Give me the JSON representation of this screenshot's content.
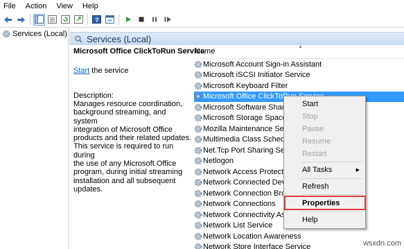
{
  "menu": [
    "File",
    "Action",
    "View",
    "Help"
  ],
  "toolbar": {
    "buttons": [
      "back-icon",
      "forward-icon",
      "show-hide-console-tree-icon",
      "export-list-icon",
      "refresh-icon",
      "properties-icon",
      "help-icon",
      "console-icon",
      "start-service-icon",
      "stop-service-icon",
      "pause-service-icon",
      "restart-service-icon"
    ],
    "colors": {
      "play": "#2a9d3a",
      "stop": "#333333"
    }
  },
  "tree": {
    "root_label": "Services (Local)"
  },
  "header": {
    "title": "Services (Local)"
  },
  "description_pane": {
    "service_name": "Microsoft Office ClickToRun Service",
    "start_link": "Start",
    "start_suffix": " the service",
    "description_label": "Description:",
    "description_lines": [
      "Manages resource coordination,",
      "background streaming, and system",
      "integration of Microsoft Office",
      "products and their related updates.",
      "This service is required to run during",
      "the use of any Microsoft Office",
      "program, during initial streaming",
      "installation and all subsequent",
      "updates."
    ]
  },
  "list": {
    "column_name": "Name",
    "selected_index": 3,
    "rows": [
      "Microsoft Account Sign-in Assistant",
      "Microsoft iSCSI Initiator Service",
      "Microsoft Keyboard Filter",
      "Microsoft Office ClickToRun Service",
      "Microsoft Software Shadow",
      "Microsoft Storage Spaces S",
      "Mozilla Maintenance Servi",
      "Multimedia Class Schedule",
      "Net.Tcp Port Sharing Servi",
      "Netlogon",
      "Network Access Protection",
      "Network Connected Devic",
      "Network Connection Brok",
      "Network Connections",
      "Network Connectivity Assi",
      "Network List Service",
      "Network Location Awareness",
      "Network Store Interface Service"
    ]
  },
  "context_menu": {
    "start": "Start",
    "stop": "Stop",
    "pause": "Pause",
    "resume": "Resume",
    "restart": "Restart",
    "all_tasks": "All Tasks",
    "refresh": "Refresh",
    "properties": "Properties",
    "help": "Help",
    "highlight_color": "#e03c3c"
  },
  "watermark": "wsxdn.com"
}
